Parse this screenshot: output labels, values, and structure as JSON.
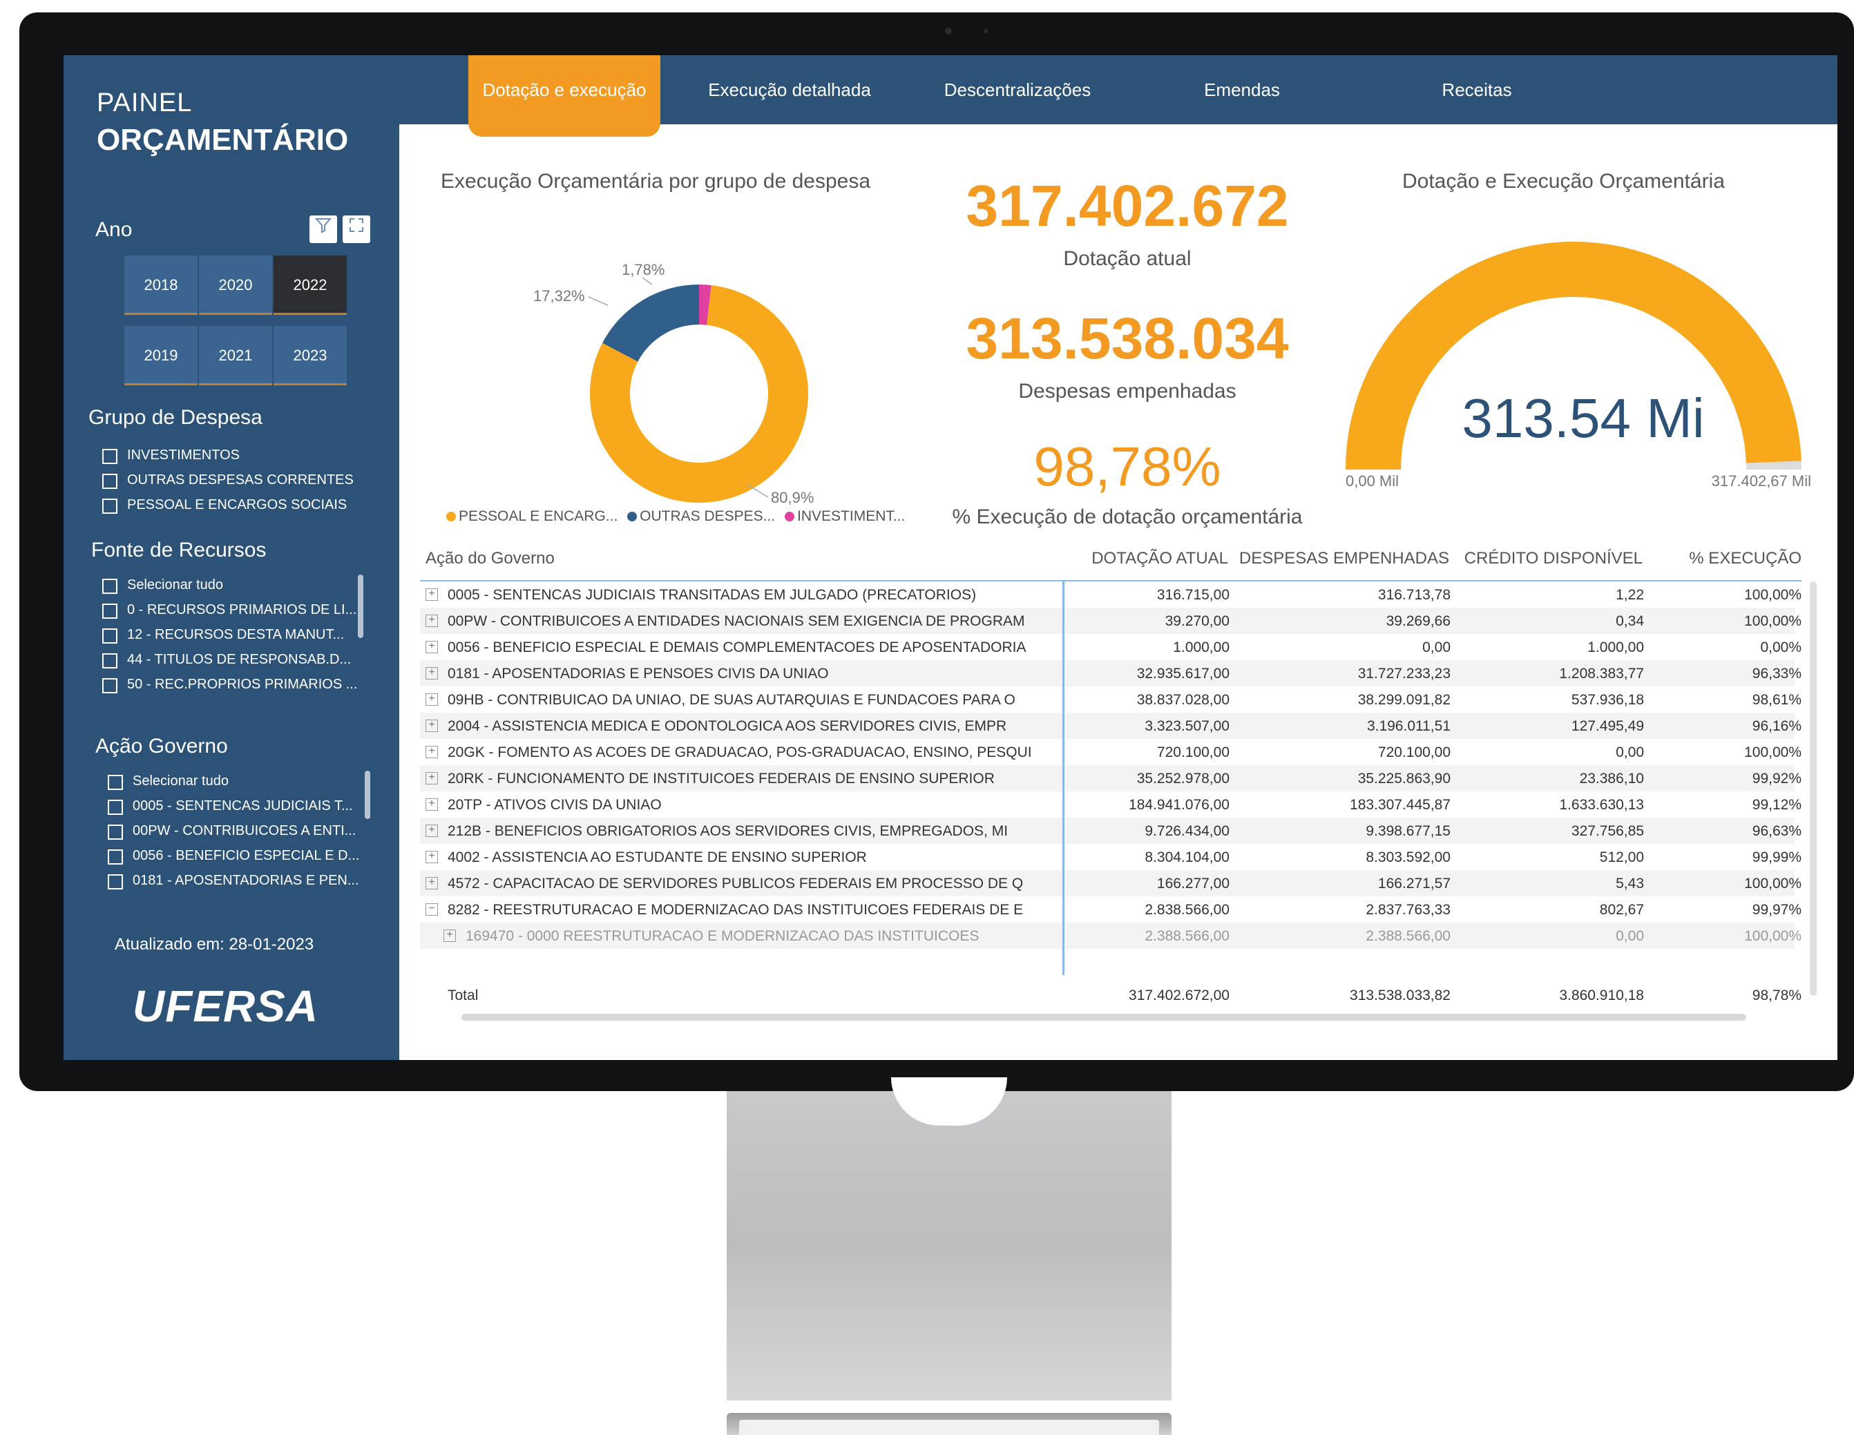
{
  "brand": {
    "line1": "PAINEL",
    "line2": "ORÇAMENTÁRIO",
    "logo": "UFERSA",
    "updated": "Atualizado em: 28-01-2023"
  },
  "tabs": [
    {
      "label": "Dotação e execução",
      "active": true
    },
    {
      "label": "Execução detalhada"
    },
    {
      "label": "Descentralizações"
    },
    {
      "label": "Emendas"
    },
    {
      "label": "Receitas"
    }
  ],
  "ano": {
    "title": "Ano",
    "years": [
      "2018",
      "2020",
      "2022",
      "2019",
      "2021",
      "2023"
    ],
    "selected": "2022"
  },
  "grupo": {
    "title": "Grupo de Despesa",
    "items": [
      "INVESTIMENTOS",
      "OUTRAS DESPESAS CORRENTES",
      "PESSOAL E ENCARGOS SOCIAIS"
    ]
  },
  "fonte": {
    "title": "Fonte de Recursos",
    "items": [
      "Selecionar tudo",
      "0 - RECURSOS PRIMARIOS DE LI...",
      "12 - RECURSOS DESTA MANUT...",
      "44 - TITULOS DE RESPONSAB.D...",
      "50 - REC.PROPRIOS PRIMARIOS ..."
    ]
  },
  "acao": {
    "title": "Ação Governo",
    "items": [
      "Selecionar tudo",
      "0005 - SENTENCAS JUDICIAIS T...",
      "00PW - CONTRIBUICOES A ENTI...",
      "0056 - BENEFICIO ESPECIAL E D...",
      "0181 - APOSENTADORIAS E PEN..."
    ]
  },
  "donut": {
    "title": "Execução Orçamentária por grupo de despesa",
    "labels": [
      "1,78%",
      "17,32%",
      "80,9%"
    ],
    "legend": [
      "PESSOAL E ENCARG...",
      "OUTRAS DESPES...",
      "INVESTIMENT..."
    ],
    "colors": {
      "pessoal": "#f7a81b",
      "outras": "#2f5f8a",
      "invest": "#e040a0"
    }
  },
  "kpis": {
    "dotacao_value": "317.402.672",
    "dotacao_label": "Dotação atual",
    "despesas_value": "313.538.034",
    "despesas_label": "Despesas empenhadas",
    "exec_value": "98,78%",
    "exec_label": "% Execução de dotação orçamentária"
  },
  "gauge": {
    "title": "Dotação e Execução Orçamentária",
    "value_label": "313.54 Mi",
    "min_label": "0,00 Mil",
    "max_label": "317.402,67 Mil",
    "value": 313.54,
    "max": 317.4
  },
  "chart_data": [
    {
      "type": "pie",
      "title": "Execução Orçamentária por grupo de despesa",
      "categories": [
        "PESSOAL E ENCARG...",
        "OUTRAS DESPES...",
        "INVESTIMENT..."
      ],
      "values": [
        80.9,
        17.32,
        1.78
      ]
    }
  ],
  "table": {
    "headers": [
      "Ação do Governo",
      "DOTAÇÃO ATUAL",
      "DESPESAS EMPENHADAS",
      "CRÉDITO DISPONÍVEL",
      "% EXECUÇÃO"
    ],
    "rows": [
      {
        "expand": "+",
        "label": "0005 - SENTENCAS JUDICIAIS TRANSITADAS EM JULGADO (PRECATORIOS)",
        "dot": "316.715,00",
        "desp": "316.713,78",
        "cred": "1,22",
        "pct": "100,00%"
      },
      {
        "expand": "+",
        "label": "00PW - CONTRIBUICOES A ENTIDADES NACIONAIS SEM EXIGENCIA DE PROGRAM",
        "dot": "39.270,00",
        "desp": "39.269,66",
        "cred": "0,34",
        "pct": "100,00%"
      },
      {
        "expand": "+",
        "label": "0056 - BENEFICIO ESPECIAL E DEMAIS COMPLEMENTACOES DE APOSENTADORIA",
        "dot": "1.000,00",
        "desp": "0,00",
        "cred": "1.000,00",
        "pct": "0,00%"
      },
      {
        "expand": "+",
        "label": "0181 - APOSENTADORIAS E PENSOES CIVIS DA UNIAO",
        "dot": "32.935.617,00",
        "desp": "31.727.233,23",
        "cred": "1.208.383,77",
        "pct": "96,33%"
      },
      {
        "expand": "+",
        "label": "09HB - CONTRIBUICAO DA UNIAO, DE SUAS AUTARQUIAS E FUNDACOES PARA O",
        "dot": "38.837.028,00",
        "desp": "38.299.091,82",
        "cred": "537.936,18",
        "pct": "98,61%"
      },
      {
        "expand": "+",
        "label": "2004 - ASSISTENCIA MEDICA E ODONTOLOGICA AOS SERVIDORES CIVIS, EMPR",
        "dot": "3.323.507,00",
        "desp": "3.196.011,51",
        "cred": "127.495,49",
        "pct": "96,16%"
      },
      {
        "expand": "+",
        "label": "20GK - FOMENTO AS ACOES DE GRADUACAO, POS-GRADUACAO, ENSINO, PESQUI",
        "dot": "720.100,00",
        "desp": "720.100,00",
        "cred": "0,00",
        "pct": "100,00%"
      },
      {
        "expand": "+",
        "label": "20RK - FUNCIONAMENTO DE INSTITUICOES FEDERAIS DE ENSINO SUPERIOR",
        "dot": "35.252.978,00",
        "desp": "35.225.863,90",
        "cred": "23.386,10",
        "pct": "99,92%"
      },
      {
        "expand": "+",
        "label": "20TP - ATIVOS CIVIS DA UNIAO",
        "dot": "184.941.076,00",
        "desp": "183.307.445,87",
        "cred": "1.633.630,13",
        "pct": "99,12%"
      },
      {
        "expand": "+",
        "label": "212B - BENEFICIOS OBRIGATORIOS AOS SERVIDORES CIVIS, EMPREGADOS, MI",
        "dot": "9.726.434,00",
        "desp": "9.398.677,15",
        "cred": "327.756,85",
        "pct": "96,63%"
      },
      {
        "expand": "+",
        "label": "4002 - ASSISTENCIA AO ESTUDANTE DE ENSINO SUPERIOR",
        "dot": "8.304.104,00",
        "desp": "8.303.592,00",
        "cred": "512,00",
        "pct": "99,99%"
      },
      {
        "expand": "+",
        "label": "4572 - CAPACITACAO DE SERVIDORES PUBLICOS FEDERAIS EM PROCESSO DE Q",
        "dot": "166.277,00",
        "desp": "166.271,57",
        "cred": "5,43",
        "pct": "100,00%"
      },
      {
        "expand": "−",
        "label": "8282 - REESTRUTURACAO E MODERNIZACAO DAS INSTITUICOES FEDERAIS DE E",
        "dot": "2.838.566,00",
        "desp": "2.837.763,33",
        "cred": "802,67",
        "pct": "99,97%"
      },
      {
        "expand": "+",
        "label": "169470 - 0000 REESTRUTURACAO E MODERNIZACAO DAS INSTITUICOES",
        "dot": "2.388.566,00",
        "desp": "2.388.566,00",
        "cred": "0,00",
        "pct": "100,00%",
        "sub": true
      }
    ],
    "total": {
      "label": "Total",
      "dot": "317.402.672,00",
      "desp": "313.538.033,82",
      "cred": "3.860.910,18",
      "pct": "98,78%"
    }
  }
}
